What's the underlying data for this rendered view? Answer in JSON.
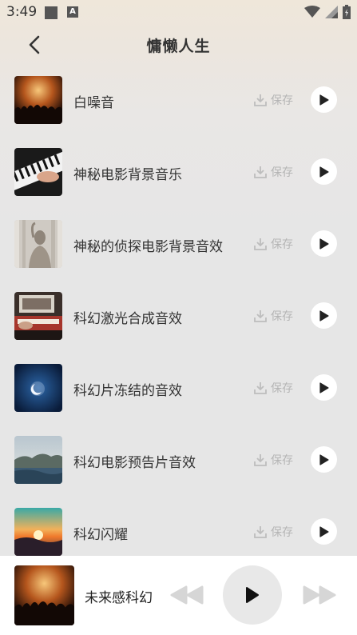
{
  "status_bar": {
    "time": "3:49",
    "icons": [
      "square-icon",
      "a-badge-icon",
      "wifi-icon",
      "signal-icon",
      "battery-icon"
    ]
  },
  "header": {
    "title": "慵懒人生",
    "back_icon": "chevron-left-icon"
  },
  "tracks": [
    {
      "name": "白噪音",
      "save_label": "保存",
      "thumb": "concert-crowd"
    },
    {
      "name": "神秘电影背景音乐",
      "save_label": "保存",
      "thumb": "piano-keys"
    },
    {
      "name": "神秘的侦探电影背景音效",
      "save_label": "保存",
      "thumb": "blurred-figure"
    },
    {
      "name": "科幻激光合成音效",
      "save_label": "保存",
      "thumb": "synthesizer"
    },
    {
      "name": "科幻片冻结的音效",
      "save_label": "保存",
      "thumb": "moon-night"
    },
    {
      "name": "科幻电影预告片音效",
      "save_label": "保存",
      "thumb": "coastal-landscape"
    },
    {
      "name": "科幻闪耀",
      "save_label": "保存",
      "thumb": "sunset-sea"
    }
  ],
  "player": {
    "title": "未来感科幻",
    "thumb": "concert-crowd",
    "controls": [
      "previous-icon",
      "play-icon",
      "next-icon"
    ]
  },
  "colors": {
    "save_text": "#b5b5b5",
    "play_bg": "#ffffff",
    "player_bg": "#ffffff",
    "big_play_bg": "#e8e8e8"
  }
}
